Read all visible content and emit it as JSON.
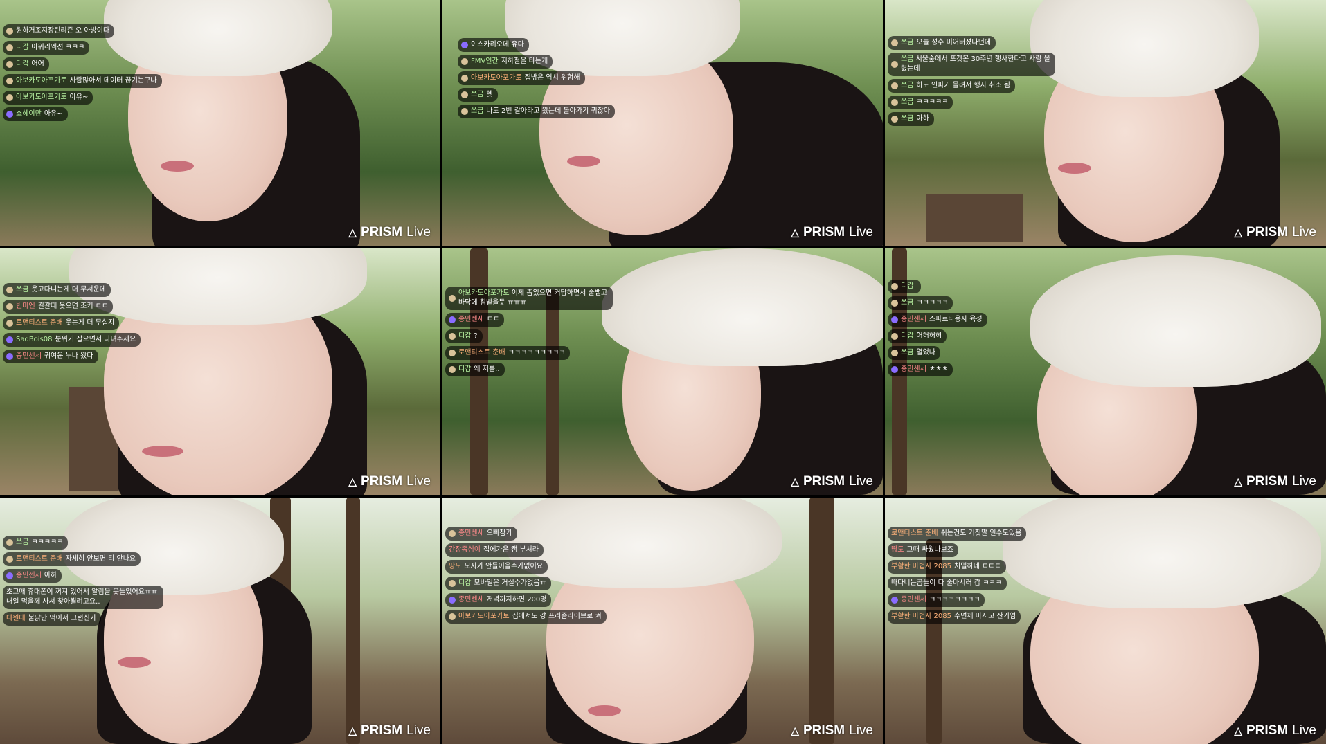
{
  "watermark": {
    "brand": "PRISM",
    "suffix": "Live"
  },
  "frames": [
    {
      "chat": [
        {
          "nick": "",
          "text": "뭔하거조지장린리즌 오 아방이다"
        },
        {
          "nick": "디갑",
          "text": "아위리엑션 ㅋㅋㅋ"
        },
        {
          "nick": "디갑",
          "text": "어어"
        },
        {
          "nick": "아보카도아포가토",
          "text": "사람많아서 데이터 끊기는구나"
        },
        {
          "nick": "아보카도아포가토",
          "text": "아유~"
        },
        {
          "nick": "쇼헤이만",
          "text": "아유~"
        }
      ]
    },
    {
      "chat": [
        {
          "nick": "",
          "text": "이스카리오데 유다"
        },
        {
          "nick": "FMV인간",
          "text": "지하철을 타는게"
        },
        {
          "nick": "아보카도아포가토",
          "text": "집밖은 역시 위험해"
        },
        {
          "nick": "쏘금",
          "text": "헷"
        },
        {
          "nick": "쏘금",
          "text": "나도 2번 갈아타고 왔는데 돌아가기 귀찮아"
        }
      ]
    },
    {
      "chat": [
        {
          "nick": "쏘금",
          "text": "오늘 성수 미어터졌다던데"
        },
        {
          "nick": "쏘금",
          "text": "서울숲에서 포켓몬 30주년 행사한다고 사람 몰렸는데"
        },
        {
          "nick": "쏘금",
          "text": "하도 인파가 몰려서 행사 취소 됨"
        },
        {
          "nick": "쏘금",
          "text": "ㅋㅋㅋㅋㅋ"
        },
        {
          "nick": "쏘금",
          "text": "아하"
        }
      ]
    },
    {
      "chat": [
        {
          "nick": "쏘금",
          "text": "웃고다니는게 더 무서운데"
        },
        {
          "nick": "빈마엔",
          "text": "길갈때 웃으면 조커 ㄷㄷ"
        },
        {
          "nick": "로맨티스트 춘배",
          "text": "웃는게 더 무섭지"
        },
        {
          "nick": "SadBois08",
          "text": "분위기 잡으면서 다녀주세요"
        },
        {
          "nick": "종민센세",
          "text": "귀여운 누나 왔다"
        }
      ]
    },
    {
      "chat": [
        {
          "nick": "아보카도아포가토",
          "text": "이제 좀있으면 커담하면서 술뱉고 바닥에 침뱉을듯 ㅠㅠㅠ"
        },
        {
          "nick": "종민센세",
          "text": "ㄷㄷ"
        },
        {
          "nick": "디갑",
          "text": "?"
        },
        {
          "nick": "로맨티스트 춘배",
          "text": "ㅋㅋㅋㅋㅋㅋㅋㅋㅋ"
        },
        {
          "nick": "디갑",
          "text": "왜 저를.."
        }
      ]
    },
    {
      "chat": [
        {
          "nick": "디갑",
          "text": ""
        },
        {
          "nick": "쏘금",
          "text": "ㅋㅋㅋㅋㅋ"
        },
        {
          "nick": "종민센세",
          "text": "스파르타용사 육성"
        },
        {
          "nick": "디갑",
          "text": "어허허허"
        },
        {
          "nick": "쏘금",
          "text": "열었나"
        },
        {
          "nick": "종민센세",
          "text": "ㅊㅊㅊ"
        }
      ]
    },
    {
      "chat": [
        {
          "nick": "쏘금",
          "text": "ㅋㅋㅋㅋㅋ"
        },
        {
          "nick": "로맨티스트 춘배",
          "text": "자세히 안보면 티 안나요"
        },
        {
          "nick": "종민센세",
          "text": "아하"
        },
        {
          "nick": "",
          "text": "초그매 휴대폰이 꺼져 있어서 알림을 못들었어요ㅠㅠ 내일 먹을께 사서 찾아뵐려고요.."
        },
        {
          "nick": "데원태",
          "text": "불닭만 먹어서 그런신가"
        }
      ]
    },
    {
      "chat": [
        {
          "nick": "종민센세",
          "text": "오빠참가"
        },
        {
          "nick": "간장종심이",
          "text": "집에가은 캠 부셔라"
        },
        {
          "nick": "땅도",
          "text": "모자가 안들어올수가없어요"
        },
        {
          "nick": "디갑",
          "text": "모바일은 거실수가없음ㅠ"
        },
        {
          "nick": "종민센세",
          "text": "저녁까지하면 200명"
        },
        {
          "nick": "아보카도아포가토",
          "text": "집에서도 걍 프리즘라이브로 켜"
        }
      ]
    },
    {
      "chat": [
        {
          "nick": "로맨티스트 춘배",
          "text": "쉬는건도 거짓말 일수도있음"
        },
        {
          "nick": "땅도",
          "text": "그때 싸웠나보죠"
        },
        {
          "nick": "부활한 마법사 2085",
          "text": "치밀하네 ㄷㄷㄷ"
        },
        {
          "nick": "",
          "text": "따다니는곰들이 다 술마시러 감 ㅋㅋㅋ"
        },
        {
          "nick": "종민센세",
          "text": "ㅋㅋㅋㅋㅋㅋㅋㅋ"
        },
        {
          "nick": "부활한 마법사 2085",
          "text": "수면제 마시고 잔기염"
        }
      ]
    }
  ]
}
